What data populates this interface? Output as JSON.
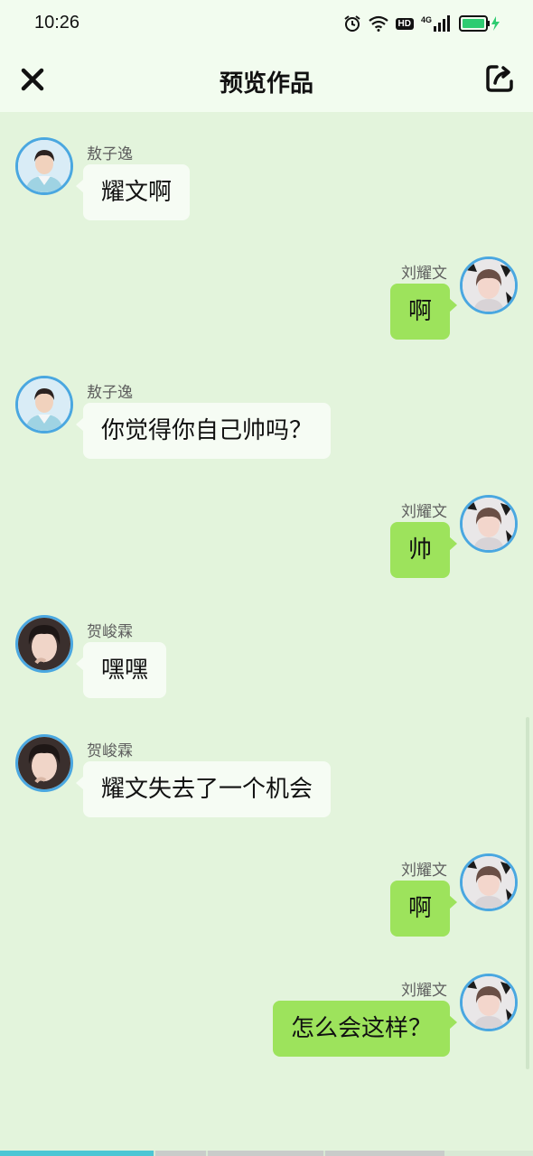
{
  "status_bar": {
    "time": "10:26",
    "hd": "HD",
    "network": "4G"
  },
  "header": {
    "title": "预览作品",
    "close_icon": "close-icon",
    "share_icon": "share-icon"
  },
  "messages": [
    {
      "side": "left",
      "sender": "敖子逸",
      "text": "耀文啊",
      "avatar": "avatar-aoziyi"
    },
    {
      "side": "right",
      "sender": "刘耀文",
      "text": "啊",
      "avatar": "avatar-liuyaowen"
    },
    {
      "side": "left",
      "sender": "敖子逸",
      "text": "你觉得你自己帅吗？",
      "avatar": "avatar-aoziyi"
    },
    {
      "side": "right",
      "sender": "刘耀文",
      "text": "帅",
      "avatar": "avatar-liuyaowen"
    },
    {
      "side": "left",
      "sender": "贺峻霖",
      "text": "嘿嘿",
      "avatar": "avatar-hejunlin"
    },
    {
      "side": "left",
      "sender": "贺峻霖",
      "text": "耀文失去了一个机会",
      "avatar": "avatar-hejunlin"
    },
    {
      "side": "right",
      "sender": "刘耀文",
      "text": "啊",
      "avatar": "avatar-liuyaowen"
    },
    {
      "side": "right",
      "sender": "刘耀文",
      "text": "怎么会这样？",
      "avatar": "avatar-liuyaowen"
    }
  ],
  "colors": {
    "background": "#e3f4dc",
    "header_bg": "#f2fcef",
    "left_bubble": "#f6fcf4",
    "right_bubble": "#9de35c",
    "avatar_ring": "#4aa7e0",
    "battery": "#2ecc71"
  }
}
